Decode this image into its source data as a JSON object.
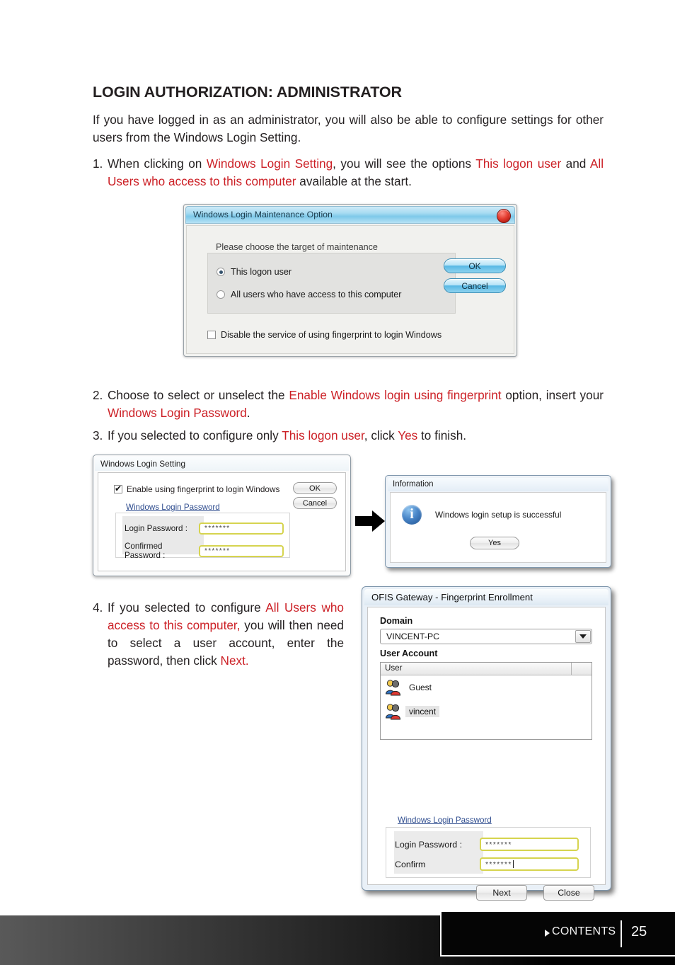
{
  "page": {
    "title": "LOGIN AUTHORIZATION: ADMINISTRATOR",
    "intro": "If you have logged in as an administrator, you will also be able to configure settings for other users from the Windows Login Setting.",
    "steps": [
      {
        "num": "1.",
        "parts": [
          {
            "t": "When clicking on ",
            "red": false
          },
          {
            "t": "Windows Login Setting",
            "red": true
          },
          {
            "t": ", you will see the options ",
            "red": false
          },
          {
            "t": "This logon user",
            "red": true
          },
          {
            "t": " and ",
            "red": false
          },
          {
            "t": "All Users who access to this computer",
            "red": true
          },
          {
            "t": " available at the start.",
            "red": false
          }
        ]
      },
      {
        "num": "2.",
        "parts": [
          {
            "t": "Choose to select or unselect the ",
            "red": false
          },
          {
            "t": "Enable Windows login using fingerprint",
            "red": true
          },
          {
            "t": " option, insert your ",
            "red": false
          },
          {
            "t": "Windows Login Password",
            "red": true
          },
          {
            "t": ".",
            "red": false
          }
        ]
      },
      {
        "num": "3.",
        "parts": [
          {
            "t": "If you selected to configure only ",
            "red": false
          },
          {
            "t": "This logon user",
            "red": true
          },
          {
            "t": ", click ",
            "red": false
          },
          {
            "t": "Yes",
            "red": true
          },
          {
            "t": " to finish.",
            "red": false
          }
        ]
      },
      {
        "num": "4.",
        "parts": [
          {
            "t": "If you selected to configure ",
            "red": false
          },
          {
            "t": "All Users who access to this computer,",
            "red": true
          },
          {
            "t": " you will then need to select a user account, enter the password, then click ",
            "red": false
          },
          {
            "t": "Next.",
            "red": true
          }
        ]
      }
    ]
  },
  "colors": {
    "accent_red": "#cc2026",
    "text": "#231f20",
    "link_blue": "#2f4d8f",
    "field_border_yellow": "#d6d44f"
  },
  "dialog_maintenance": {
    "title": "Windows Login Maintenance Option",
    "close_icon": "close-icon",
    "prompt": "Please choose the target of maintenance",
    "options": [
      {
        "label": "This logon user",
        "selected": true
      },
      {
        "label": "All users who have access to this computer",
        "selected": false
      }
    ],
    "checkbox": {
      "label": "Disable the service of using fingerprint to login Windows",
      "checked": false
    },
    "buttons": {
      "ok": "OK",
      "cancel": "Cancel"
    }
  },
  "dialog_login_setting": {
    "title": "Windows Login Setting",
    "checkbox": {
      "label": "Enable using fingerprint to login Windows",
      "checked": true
    },
    "group_link": "Windows Login Password",
    "fields": [
      {
        "label": "Login Password :",
        "value": "*******"
      },
      {
        "label": "Confirmed Password :",
        "value": "*******"
      }
    ],
    "buttons": {
      "ok": "OK",
      "cancel": "Cancel"
    }
  },
  "arrow": {
    "name": "right-arrow",
    "direction": "right"
  },
  "dialog_information": {
    "title": "Information",
    "icon": "info-icon",
    "message": "Windows login setup is successful",
    "buttons": {
      "yes": "Yes"
    }
  },
  "dialog_ofis": {
    "title": "OFIS Gateway - Fingerprint Enrollment",
    "domain_label": "Domain",
    "domain_value": "VINCENT-PC",
    "user_account_label": "User Account",
    "list_header": "User",
    "users": [
      {
        "name": "Guest",
        "selected": false
      },
      {
        "name": "vincent",
        "selected": true
      }
    ],
    "group_link": "Windows Login Password",
    "fields": [
      {
        "label": "Login Password :",
        "value": "*******"
      },
      {
        "label": "Confirm",
        "value": "*******"
      }
    ],
    "buttons": {
      "next": "Next",
      "close": "Close"
    }
  },
  "footer": {
    "contents_label": "CONTENTS",
    "page_number": "25"
  }
}
